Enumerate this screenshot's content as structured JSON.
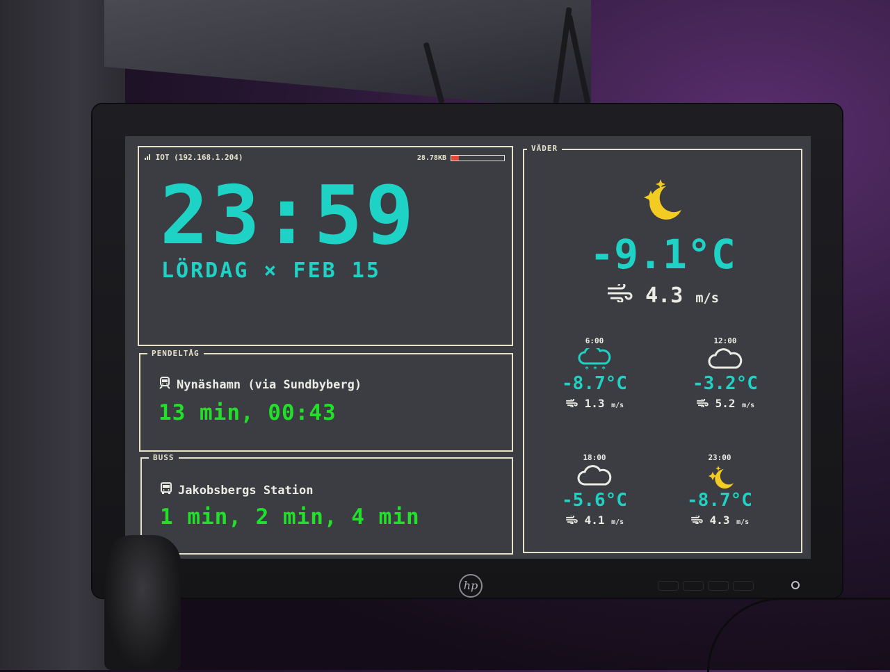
{
  "status": {
    "network": "IOT (192.168.1.204)",
    "memory": "28.78KB",
    "memory_fraction": 0.15
  },
  "clock": {
    "time": "23:59",
    "date": "LÖRDAG × FEB 15"
  },
  "train": {
    "label": "PENDELTÅG",
    "route": "Nynäshamn (via Sundbyberg)",
    "departures": "13 min, 00:43"
  },
  "bus": {
    "label": "BUSS",
    "route": "Jakobsbergs Station",
    "departures": "1 min, 2 min, 4 min"
  },
  "weather": {
    "label": "VÄDER",
    "now": {
      "icon": "moon-stars-icon",
      "temp": "-9.1°C",
      "wind": "4.3",
      "wind_unit": "m/s"
    },
    "forecast": [
      {
        "time": "6:00",
        "icon": "cloud-snow-icon",
        "temp": "-8.7°C",
        "wind": "1.3",
        "wind_unit": "m/s"
      },
      {
        "time": "12:00",
        "icon": "cloud-icon",
        "temp": "-3.2°C",
        "wind": "5.2",
        "wind_unit": "m/s"
      },
      {
        "time": "18:00",
        "icon": "cloud-icon",
        "temp": "-5.6°C",
        "wind": "4.1",
        "wind_unit": "m/s"
      },
      {
        "time": "23:00",
        "icon": "moon-stars-icon",
        "temp": "-8.7°C",
        "wind": "4.3",
        "wind_unit": "m/s"
      }
    ]
  },
  "colors": {
    "accent": "#1fd2c6",
    "departures": "#22e02a",
    "frame": "#e6e2cc",
    "moon": "#f2cc22",
    "memory_bar": "#e34a3a"
  }
}
